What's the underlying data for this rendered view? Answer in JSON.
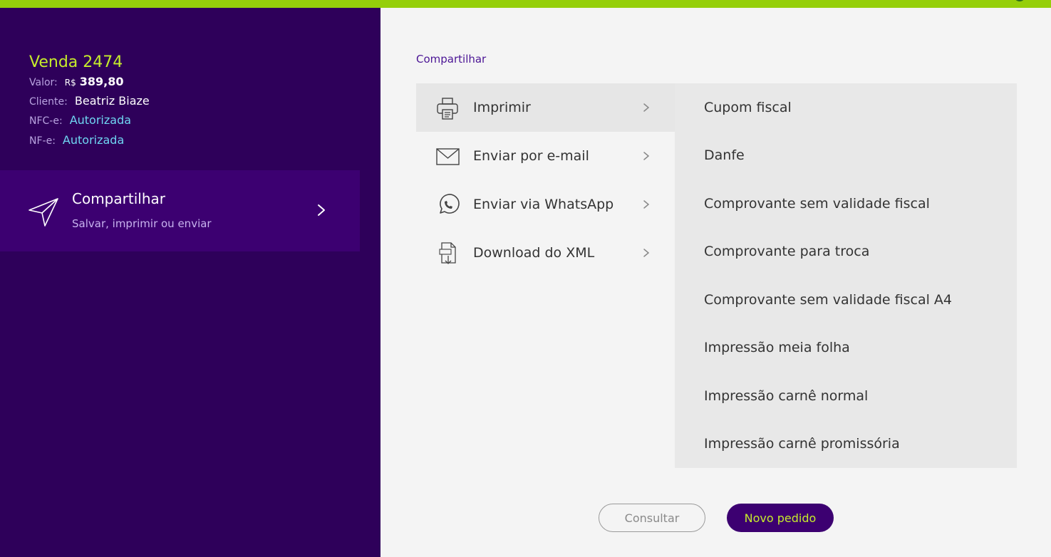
{
  "colors": {
    "topbar": "#95cf0a",
    "sidebar_bg": "#2e005a",
    "card_bg": "#3c0071",
    "accent_green": "#c6ec2b",
    "status_cyan": "#6fd6f2",
    "primary_purple": "#3c0071"
  },
  "sale": {
    "title": "Venda 2474",
    "value_label": "Valor:",
    "currency": "R$",
    "amount": "389,80",
    "client_label": "Cliente:",
    "client_name": "Beatriz Biaze",
    "nfce_label": "NFC-e:",
    "nfce_status": "Autorizada",
    "nfe_label": "NF-e:",
    "nfe_status": "Autorizada"
  },
  "share_card": {
    "title": "Compartilhar",
    "subtitle": "Salvar, imprimir ou enviar",
    "icon": "paper-plane-icon"
  },
  "breadcrumb": "Compartilhar",
  "menu": [
    {
      "label": "Imprimir",
      "icon": "printer-icon",
      "active": true
    },
    {
      "label": "Enviar por e-mail",
      "icon": "envelope-icon",
      "active": false
    },
    {
      "label": "Enviar via WhatsApp",
      "icon": "whatsapp-icon",
      "active": false
    },
    {
      "label": "Download do XML",
      "icon": "xml-download-icon",
      "active": false
    }
  ],
  "submenu": [
    "Cupom fiscal",
    "Danfe",
    "Comprovante sem validade fiscal",
    "Comprovante para troca",
    "Comprovante sem validade fiscal A4",
    "Impressão meia folha",
    "Impressão carnê normal",
    "Impressão carnê promissória"
  ],
  "buttons": {
    "consultar": "Consultar",
    "novo_pedido": "Novo pedido"
  }
}
